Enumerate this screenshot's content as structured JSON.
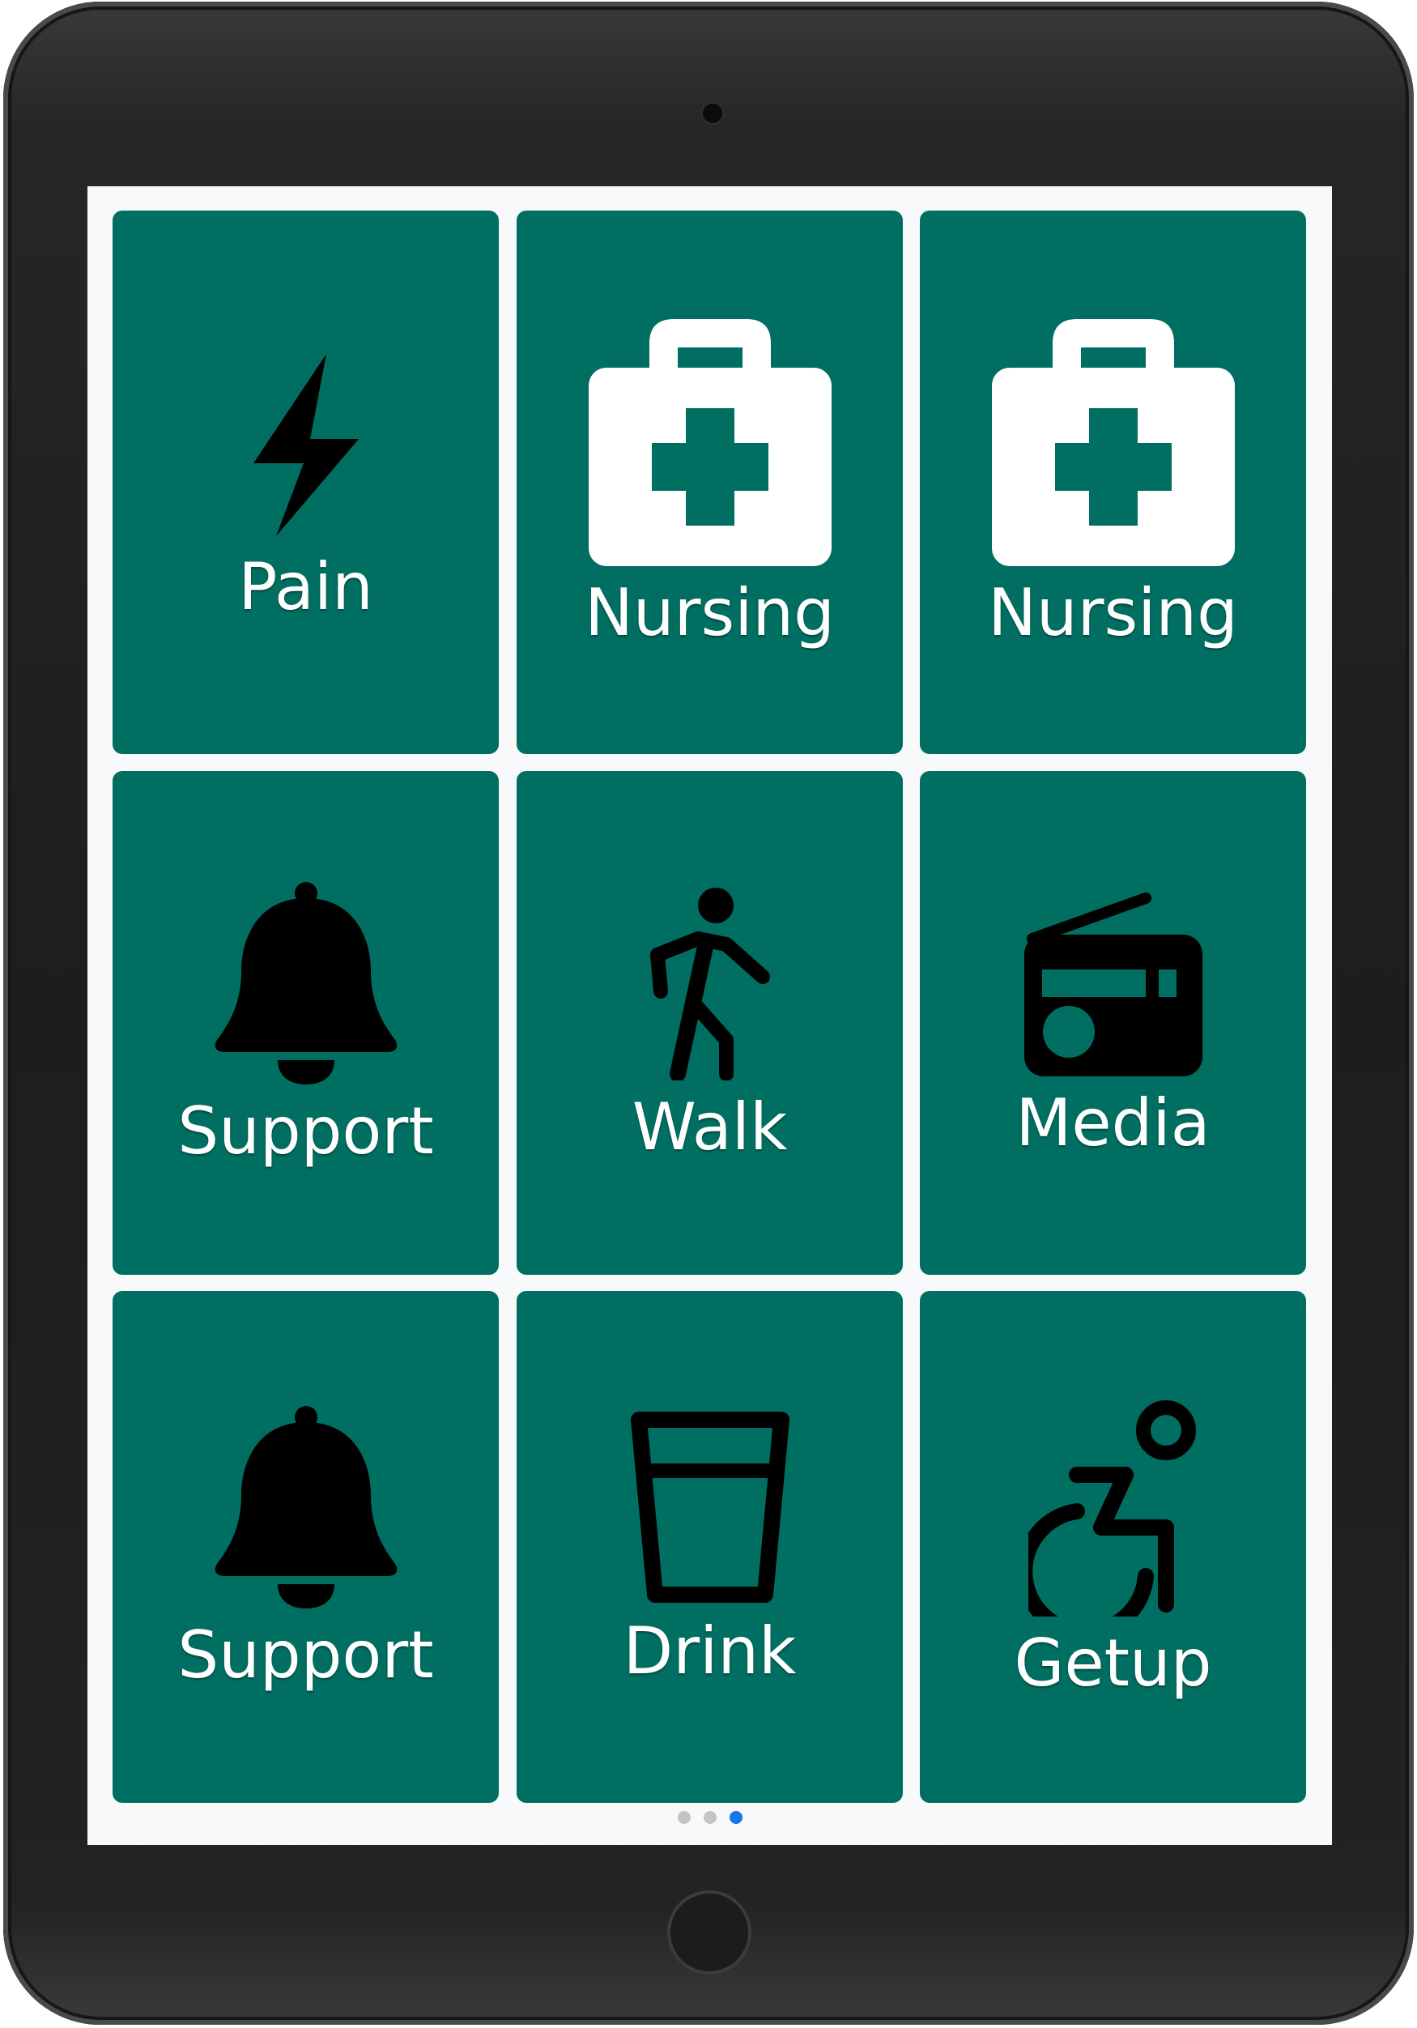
{
  "tiles": [
    {
      "label": "Pain",
      "icon": "lightning-bolt-icon"
    },
    {
      "label": "Nursing",
      "icon": "medical-kit-icon"
    },
    {
      "label": "Nursing",
      "icon": "medical-kit-icon"
    },
    {
      "label": "Support",
      "icon": "bell-icon"
    },
    {
      "label": "Walk",
      "icon": "walking-person-icon"
    },
    {
      "label": "Media",
      "icon": "radio-icon"
    },
    {
      "label": "Support",
      "icon": "bell-icon"
    },
    {
      "label": "Drink",
      "icon": "glass-icon"
    },
    {
      "label": "Getup",
      "icon": "wheelchair-icon"
    }
  ],
  "pager": {
    "pages": 3,
    "active_page": 3
  },
  "colors": {
    "tile": "#006e61",
    "label": "#ffffff",
    "icon_dark": "#000000",
    "icon_light": "#ffffff",
    "active_dot": "#1a73e8",
    "inactive_dot": "#c4c4c4"
  }
}
